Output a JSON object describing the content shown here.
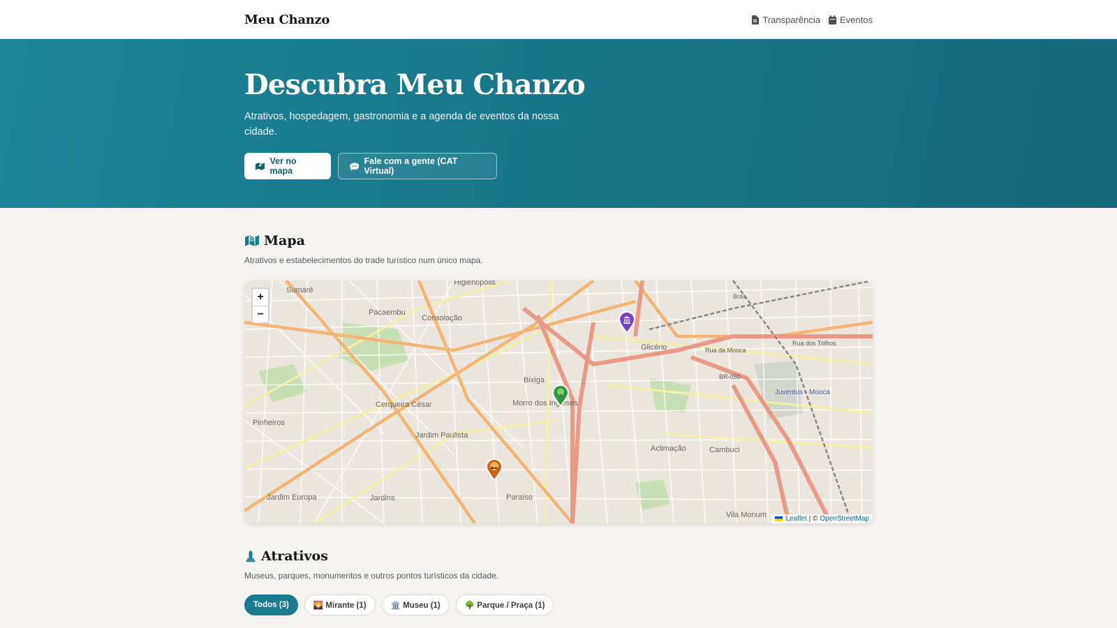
{
  "header": {
    "brand": "Meu Chanzo",
    "nav": [
      {
        "label": "Transparência",
        "icon": "document-icon"
      },
      {
        "label": "Eventos",
        "icon": "calendar-icon"
      }
    ]
  },
  "hero": {
    "title": "Descubra Meu Chanzo",
    "subtitle": "Atrativos, hospedagem, gastronomia e a agenda de eventos da nossa cidade.",
    "primary_button": "Ver no mapa",
    "secondary_button": "Fale com a gente (CAT Virtual)"
  },
  "map_section": {
    "title": "Mapa",
    "description": "Atrativos e estabelecimentos do trade turístico num único mapa.",
    "zoom_in": "+",
    "zoom_out": "−",
    "attribution_leaflet": "Leaflet",
    "attribution_sep": "| ©",
    "attribution_osm": "OpenStreetMap",
    "labels": [
      "Higienópolis",
      "Sumaré",
      "Pacaembu",
      "Consolação",
      "Bixiga",
      "Morro dos Ingleses",
      "Cerqueira César",
      "Pinheiros",
      "Jardim Paulista",
      "Jardim Europa",
      "Jardins",
      "Paraíso",
      "Aclimação",
      "Cambuci",
      "Glicério",
      "Juventus - Mooca",
      "Vila Monum",
      "Brás",
      "Rua da Mooca",
      "Rua dos Trilhos",
      "BR-050"
    ],
    "markers": [
      {
        "category": "Museu",
        "color": "#7b3fc4"
      },
      {
        "category": "Parque / Praça",
        "color": "#2e9a3e"
      },
      {
        "category": "Mirante",
        "color": "#c9631c"
      }
    ]
  },
  "attractions_section": {
    "title": "Atrativos",
    "description": "Museus, parques, monumentos e outros pontos turísticos da cidade.",
    "filters": [
      {
        "label": "Todos (3)",
        "active": true
      },
      {
        "label": "🌄 Mirante (1)",
        "active": false
      },
      {
        "label": "🏛️ Museu (1)",
        "active": false
      },
      {
        "label": "🌳 Parque / Praça (1)",
        "active": false
      }
    ]
  },
  "colors": {
    "accent": "#1a7a8e",
    "hero_start": "#1b8499",
    "hero_end": "#16687d",
    "background": "#f4f3ef"
  }
}
